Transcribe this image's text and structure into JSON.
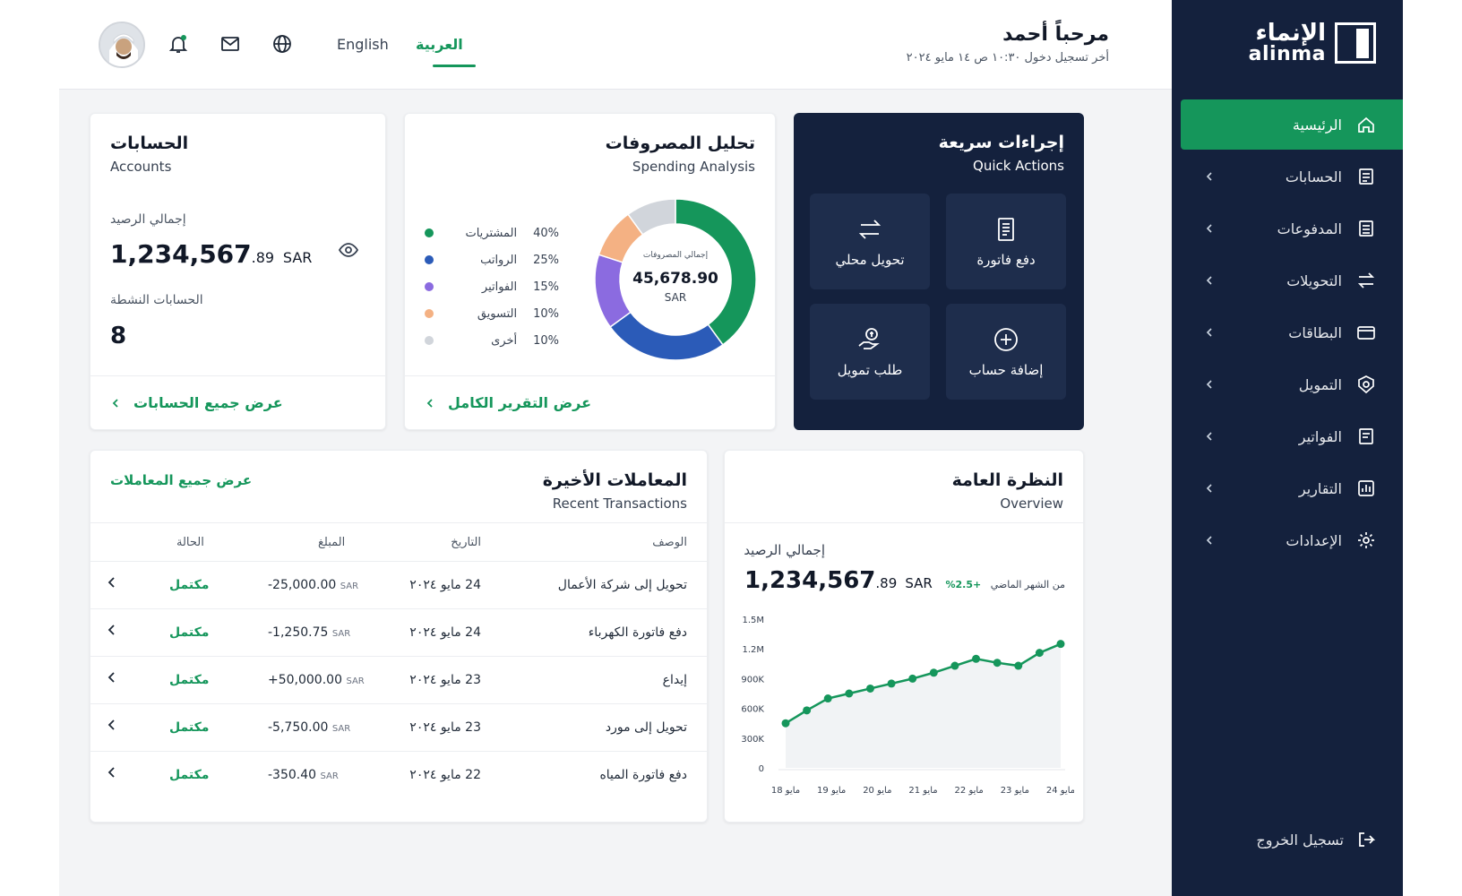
{
  "sidebar": {
    "logo_ar": "الإنماء",
    "logo_en": "alinma",
    "items": [
      {
        "label": "الرئيسية",
        "icon": "home-icon",
        "active": true
      },
      {
        "label": "الحسابات",
        "icon": "document-icon"
      },
      {
        "label": "المدفوعات",
        "icon": "list-icon"
      },
      {
        "label": "التحويلات",
        "icon": "transfer-icon"
      },
      {
        "label": "البطاقات",
        "icon": "card-icon"
      },
      {
        "label": "التمويل",
        "icon": "finance-icon"
      },
      {
        "label": "الفواتير",
        "icon": "bill-icon"
      },
      {
        "label": "التقارير",
        "icon": "report-icon"
      },
      {
        "label": "الإعدادات",
        "icon": "gear-icon"
      }
    ],
    "logout": "تسجيل الخروج"
  },
  "header": {
    "greeting": "مرحباً أحمد",
    "last_login": "أخر تسجيل دخول ١٠:٣٠ ص   ١٤ مايو ٢٠٢٤",
    "lang_en": "English",
    "lang_ar": "العربية"
  },
  "quick_actions": {
    "title_ar": "إجراءات سريعة",
    "title_en": "Quick Actions",
    "buttons": [
      {
        "label": "دفع فاتورة",
        "icon": "bill-icon"
      },
      {
        "label": "تحويل محلي",
        "icon": "transfer-icon"
      },
      {
        "label": "إضافة حساب",
        "icon": "plus-circle-icon"
      },
      {
        "label": "طلب تمويل",
        "icon": "hand-coin-icon"
      }
    ]
  },
  "spending": {
    "title_ar": "تحليل المصروفات",
    "title_en": "Spending Analysis",
    "center_label": "إجمالي المصروفات",
    "center_value": "45,678.90",
    "center_currency": "SAR",
    "link": "عرض التقرير الكامل",
    "colors": [
      "#15965b",
      "#2b5bb8",
      "#8b6be0",
      "#f4b183",
      "#d1d5db"
    ]
  },
  "accounts": {
    "title_ar": "الحسابات",
    "title_en": "Accounts",
    "balance_label": "إجمالي الرصيد",
    "balance_main": "1,234,567",
    "balance_cents": ".89",
    "currency": "SAR",
    "active_label": "الحسابات النشطة",
    "active_count": "8",
    "link": "عرض جميع الحسابات"
  },
  "transactions": {
    "title_ar": "المعاملات الأخيرة",
    "title_en": "Recent Transactions",
    "view_all": "عرض جميع المعاملات",
    "columns": {
      "desc": "الوصف",
      "date": "التاريخ",
      "amount": "المبلغ",
      "status": "الحالة"
    },
    "rows": [
      {
        "desc": "تحويل إلى شركة الأعمال",
        "date": "24 مايو ٢٠٢٤",
        "amount": "-25,000.00",
        "cur": "SAR",
        "status": "مكتمل"
      },
      {
        "desc": "دفع فاتورة الكهرباء",
        "date": "24 مايو ٢٠٢٤",
        "amount": "-1,250.75",
        "cur": "SAR",
        "status": "مكتمل"
      },
      {
        "desc": "إيداع",
        "date": "23 مايو ٢٠٢٤",
        "amount": "+50,000.00",
        "cur": "SAR",
        "status": "مكتمل"
      },
      {
        "desc": "تحويل إلى مورد",
        "date": "23 مايو ٢٠٢٤",
        "amount": "-5,750.00",
        "cur": "SAR",
        "status": "مكتمل"
      },
      {
        "desc": "دفع فاتورة المياه",
        "date": "22 مايو ٢٠٢٤",
        "amount": "-350.40",
        "cur": "SAR",
        "status": "مكتمل"
      }
    ]
  },
  "overview": {
    "title_ar": "النظرة العامة",
    "title_en": "Overview",
    "balance_label": "إجمالي الرصيد",
    "balance_main": "1,234,567",
    "balance_cents": ".89",
    "currency": "SAR",
    "change_label": "من الشهر الماضي",
    "change_value": "+2.5%"
  },
  "chart_data": [
    {
      "type": "pie",
      "categories": [
        "المشتريات",
        "الرواتب",
        "الفواتير",
        "التسويق",
        "أخرى"
      ],
      "values": [
        40,
        25,
        15,
        10,
        10
      ],
      "labels": [
        "40%",
        "25%",
        "15%",
        "10%",
        "10%"
      ],
      "title": "تحليل المصروفات"
    },
    {
      "type": "line",
      "x": [
        "18 مايو",
        "19 مايو",
        "20 مايو",
        "21 مايو",
        "22 مايو",
        "23 مايو",
        "24 مايو"
      ],
      "y": [
        450000,
        580000,
        700000,
        750000,
        800000,
        850000,
        900000,
        960000,
        1030000,
        1100000,
        1060000,
        1030000,
        1160000,
        1250000
      ],
      "yticks": [
        "0",
        "300K",
        "600K",
        "900K",
        "1.2M",
        "1.5M"
      ],
      "ylim": [
        0,
        1500000
      ],
      "grid": false,
      "color": "#15965b"
    }
  ]
}
